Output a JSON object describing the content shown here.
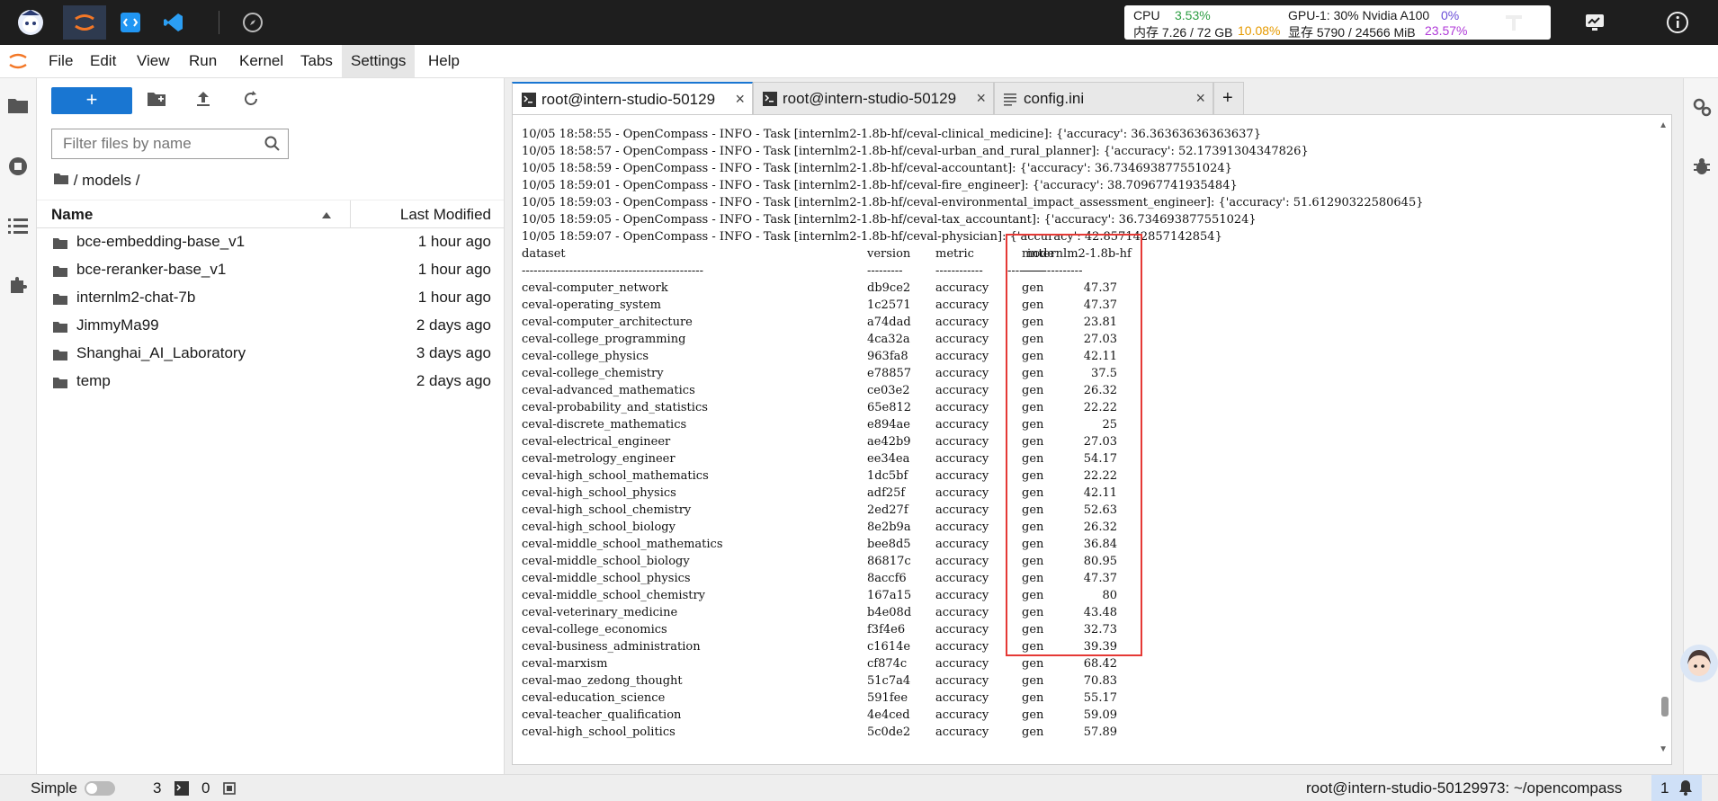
{
  "stats": {
    "cpu_label": "CPU",
    "cpu_value": "3.53%",
    "mem_label": "内存 7.26 / 72 GB",
    "mem_value": "10.08%",
    "gpu_label": "GPU-1: 30% Nvidia A100",
    "gpu_value": "0%",
    "vram_label": "显存 5790 / 24566 MiB",
    "vram_value": "23.57%"
  },
  "menu": [
    "File",
    "Edit",
    "View",
    "Run",
    "Kernel",
    "Tabs",
    "Settings",
    "Help"
  ],
  "filebrowser": {
    "new_label": "+",
    "filter_placeholder": "Filter files by name",
    "breadcrumb": "/ models /",
    "col_name": "Name",
    "col_modified": "Last Modified",
    "files": [
      {
        "name": "bce-embedding-base_v1",
        "modified": "1 hour ago"
      },
      {
        "name": "bce-reranker-base_v1",
        "modified": "1 hour ago"
      },
      {
        "name": "internlm2-chat-7b",
        "modified": "1 hour ago"
      },
      {
        "name": "JimmyMa99",
        "modified": "2 days ago"
      },
      {
        "name": "Shanghai_AI_Laboratory",
        "modified": "3 days ago"
      },
      {
        "name": "temp",
        "modified": "2 days ago"
      }
    ]
  },
  "tabs": [
    {
      "label": "root@intern-studio-50129",
      "close": "×"
    },
    {
      "label": "root@intern-studio-50129",
      "close": "×"
    },
    {
      "label": "config.ini",
      "close": "×"
    }
  ],
  "add_tab": "+",
  "terminal": {
    "log_lines": [
      "10/05 18:58:55 - OpenCompass - INFO - Task [internlm2-1.8b-hf/ceval-clinical_medicine]: {'accuracy': 36.36363636363637}",
      "10/05 18:58:57 - OpenCompass - INFO - Task [internlm2-1.8b-hf/ceval-urban_and_rural_planner]: {'accuracy': 52.17391304347826}",
      "10/05 18:58:59 - OpenCompass - INFO - Task [internlm2-1.8b-hf/ceval-accountant]: {'accuracy': 36.734693877551024}",
      "10/05 18:59:01 - OpenCompass - INFO - Task [internlm2-1.8b-hf/ceval-fire_engineer]: {'accuracy': 38.70967741935484}",
      "10/05 18:59:03 - OpenCompass - INFO - Task [internlm2-1.8b-hf/ceval-environmental_impact_assessment_engineer]: {'accuracy': 51.61290322580645}",
      "10/05 18:59:05 - OpenCompass - INFO - Task [internlm2-1.8b-hf/ceval-tax_accountant]: {'accuracy': 36.734693877551024}",
      "10/05 18:59:07 - OpenCompass - INFO - Task [internlm2-1.8b-hf/ceval-physician]: {'accuracy': 42.857142857142854}"
    ],
    "headers": [
      "dataset",
      "version",
      "metric",
      "mode",
      "internlm2-1.8b-hf"
    ],
    "separator": [
      "----------------------------------------------",
      "---------",
      "------------",
      "------",
      "-------------------"
    ],
    "rows": [
      [
        "ceval-computer_network",
        "db9ce2",
        "accuracy",
        "gen",
        "47.37"
      ],
      [
        "ceval-operating_system",
        "1c2571",
        "accuracy",
        "gen",
        "47.37"
      ],
      [
        "ceval-computer_architecture",
        "a74dad",
        "accuracy",
        "gen",
        "23.81"
      ],
      [
        "ceval-college_programming",
        "4ca32a",
        "accuracy",
        "gen",
        "27.03"
      ],
      [
        "ceval-college_physics",
        "963fa8",
        "accuracy",
        "gen",
        "42.11"
      ],
      [
        "ceval-college_chemistry",
        "e78857",
        "accuracy",
        "gen",
        "37.5"
      ],
      [
        "ceval-advanced_mathematics",
        "ce03e2",
        "accuracy",
        "gen",
        "26.32"
      ],
      [
        "ceval-probability_and_statistics",
        "65e812",
        "accuracy",
        "gen",
        "22.22"
      ],
      [
        "ceval-discrete_mathematics",
        "e894ae",
        "accuracy",
        "gen",
        "25"
      ],
      [
        "ceval-electrical_engineer",
        "ae42b9",
        "accuracy",
        "gen",
        "27.03"
      ],
      [
        "ceval-metrology_engineer",
        "ee34ea",
        "accuracy",
        "gen",
        "54.17"
      ],
      [
        "ceval-high_school_mathematics",
        "1dc5bf",
        "accuracy",
        "gen",
        "22.22"
      ],
      [
        "ceval-high_school_physics",
        "adf25f",
        "accuracy",
        "gen",
        "42.11"
      ],
      [
        "ceval-high_school_chemistry",
        "2ed27f",
        "accuracy",
        "gen",
        "52.63"
      ],
      [
        "ceval-high_school_biology",
        "8e2b9a",
        "accuracy",
        "gen",
        "26.32"
      ],
      [
        "ceval-middle_school_mathematics",
        "bee8d5",
        "accuracy",
        "gen",
        "36.84"
      ],
      [
        "ceval-middle_school_biology",
        "86817c",
        "accuracy",
        "gen",
        "80.95"
      ],
      [
        "ceval-middle_school_physics",
        "8accf6",
        "accuracy",
        "gen",
        "47.37"
      ],
      [
        "ceval-middle_school_chemistry",
        "167a15",
        "accuracy",
        "gen",
        "80"
      ],
      [
        "ceval-veterinary_medicine",
        "b4e08d",
        "accuracy",
        "gen",
        "43.48"
      ],
      [
        "ceval-college_economics",
        "f3f4e6",
        "accuracy",
        "gen",
        "32.73"
      ],
      [
        "ceval-business_administration",
        "c1614e",
        "accuracy",
        "gen",
        "39.39"
      ],
      [
        "ceval-marxism",
        "cf874c",
        "accuracy",
        "gen",
        "68.42"
      ],
      [
        "ceval-mao_zedong_thought",
        "51c7a4",
        "accuracy",
        "gen",
        "70.83"
      ],
      [
        "ceval-education_science",
        "591fee",
        "accuracy",
        "gen",
        "55.17"
      ],
      [
        "ceval-teacher_qualification",
        "4e4ced",
        "accuracy",
        "gen",
        "59.09"
      ],
      [
        "ceval-high_school_politics",
        "5c0de2",
        "accuracy",
        "gen",
        "57.89"
      ]
    ]
  },
  "statusbar": {
    "simple_label": "Simple",
    "terminals_count": "3",
    "kernels_count": "0",
    "path": "root@intern-studio-50129973: ~/opencompass",
    "notifications": "1"
  },
  "colors": {
    "accent": "#1976d2",
    "highlight_box": "#e53935",
    "cpu": "#2e9e44",
    "mem": "#e69a00",
    "gpu": "#6b4fd8",
    "vram": "#b03ad8"
  }
}
